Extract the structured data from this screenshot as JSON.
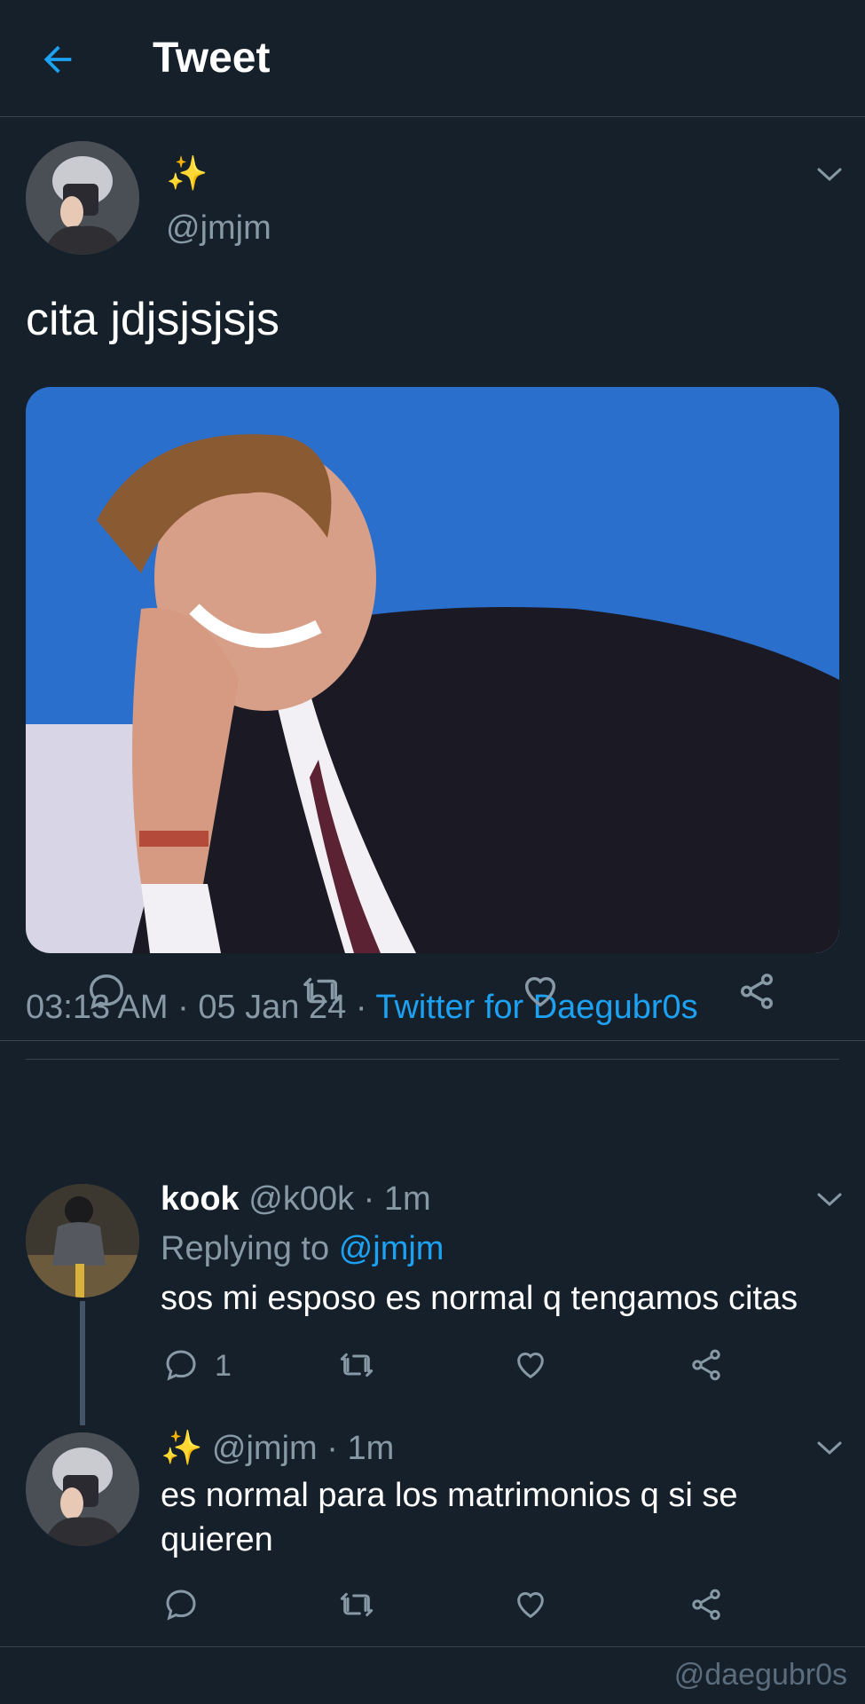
{
  "header": {
    "title": "Tweet"
  },
  "main_tweet": {
    "display_name": "✨",
    "handle": "@jmjm",
    "text": "cita jdjsjsjsjs",
    "time": "03:13 AM",
    "separator": "·",
    "date": "05 Jan 24",
    "source": "Twitter for Daegubr0s"
  },
  "replies": [
    {
      "name": "kook",
      "handle": "@k00k",
      "time_sep": "·",
      "time": "1m",
      "replying_to_label": "Replying to",
      "replying_to_handle": "@jmjm",
      "text": "sos mi esposo es normal q tengamos citas",
      "reply_count": "1"
    },
    {
      "name_emoji": "✨",
      "handle": "@jmjm",
      "time_sep": "·",
      "time": "1m",
      "text": "es normal para los matrimonios q si se quieren"
    }
  ],
  "watermark": "@daegubr0s",
  "colors": {
    "background": "#15202b",
    "accent": "#1da1f2",
    "muted": "#8899a6",
    "divider": "#38444d"
  },
  "icons": {
    "back": "arrow-left-icon",
    "caret": "chevron-down-icon",
    "reply": "comment-icon",
    "retweet": "retweet-icon",
    "like": "heart-icon",
    "share": "share-icon"
  }
}
